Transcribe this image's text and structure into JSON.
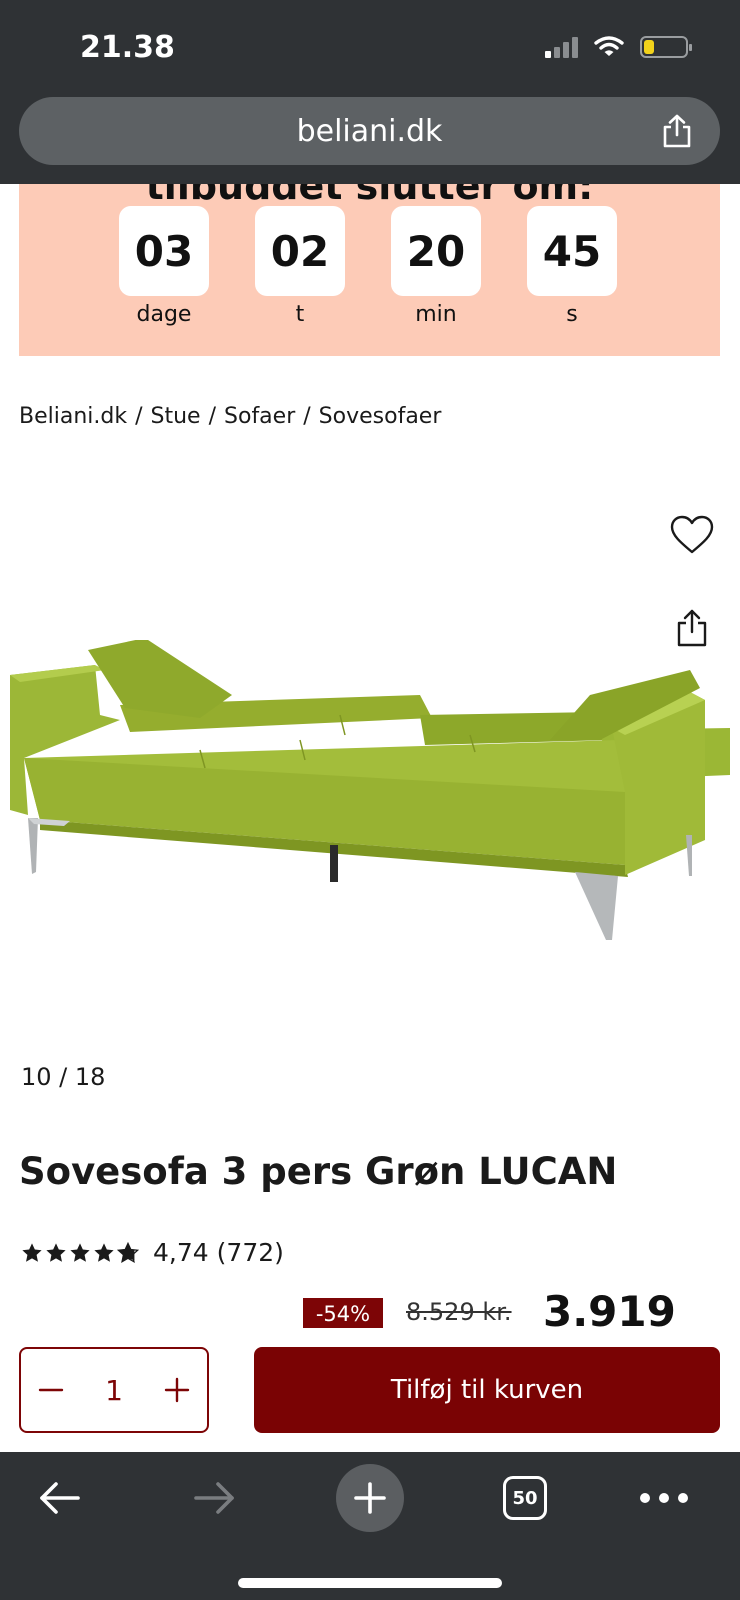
{
  "status_bar": {
    "time": "21.38",
    "icons": [
      "cellular-signal-icon",
      "wifi-icon",
      "battery-icon"
    ]
  },
  "address_bar": {
    "url": "beliani.dk",
    "share_icon": "share-icon"
  },
  "countdown": {
    "header_partial": "tilbuddet slutter om:",
    "units": [
      {
        "value": "03",
        "label": "dage"
      },
      {
        "value": "02",
        "label": "t"
      },
      {
        "value": "20",
        "label": "min"
      },
      {
        "value": "45",
        "label": "s"
      }
    ],
    "background_color": "#fdcbb7"
  },
  "breadcrumb": {
    "items": [
      "Beliani.dk",
      "Stue",
      "Sofaer",
      "Sovesofaer"
    ],
    "separator": "/"
  },
  "gallery": {
    "pager": "10 / 18",
    "favorite_icon": "heart-icon",
    "share_icon": "share-icon",
    "image_subject": "green sofa bed unfolded"
  },
  "product": {
    "title": "Sovesofa 3 pers Grøn LUCAN",
    "rating_value": "4,74",
    "rating_count": "(772)",
    "stars": 4.74,
    "discount": "-54%",
    "old_price": "8.529 kr.",
    "new_price": "3.919 kr."
  },
  "cart": {
    "quantity": "1",
    "add_label": "Tilføj til kurven",
    "accent_color": "#7a0304"
  },
  "browser_bottom": {
    "tab_count": "50",
    "icons": [
      "back-arrow-icon",
      "forward-arrow-icon",
      "new-tab-plus-icon",
      "tabs-icon",
      "more-icon"
    ]
  }
}
